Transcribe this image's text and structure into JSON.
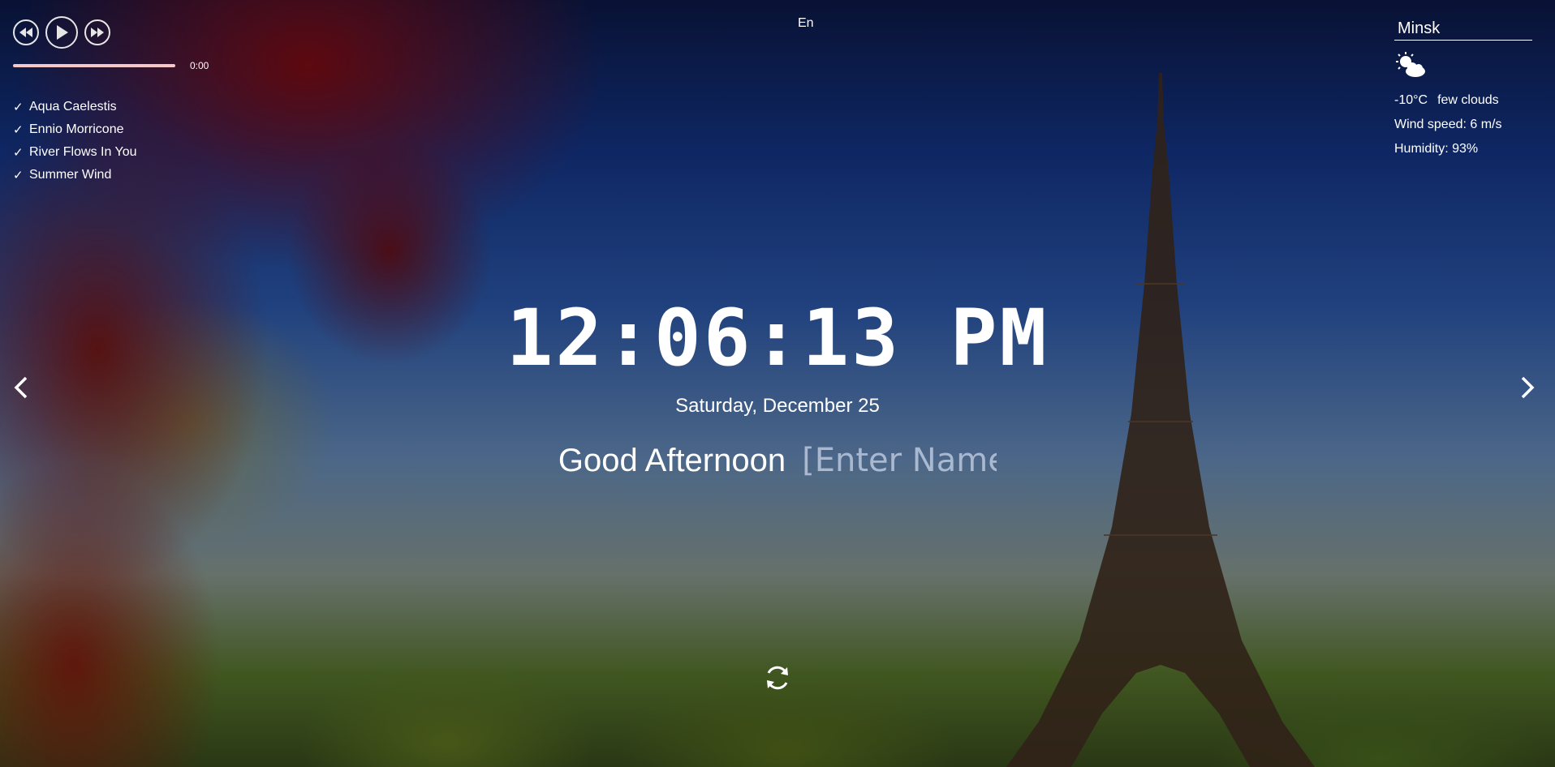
{
  "player": {
    "prev_icon": "rewind-icon",
    "play_icon": "play-icon",
    "next_icon": "fast-forward-icon",
    "progress": 0,
    "time": "0:00",
    "playlist": [
      "Aqua Caelestis",
      "Ennio Morricone",
      "River Flows In You",
      "Summer Wind"
    ]
  },
  "language": "En",
  "weather": {
    "city": "Minsk",
    "icon": "few-clouds-icon",
    "temperature": "-10°C",
    "description": "few clouds",
    "wind": "Wind speed: 6 m/s",
    "humidity": "Humidity: 93%"
  },
  "clock": {
    "time": "12:06:13 PM"
  },
  "date": "Saturday, December 25",
  "greeting": {
    "text": "Good Afternoon",
    "name_placeholder": "[Enter Name]"
  },
  "slider": {
    "prev_icon": "chevron-left-icon",
    "next_icon": "chevron-right-icon"
  },
  "quote": {
    "refresh_icon": "refresh-icon"
  },
  "colors": {
    "progress_track": "#f6c7c7",
    "progress_fill": "#ff8a8a",
    "text": "#ffffff"
  }
}
